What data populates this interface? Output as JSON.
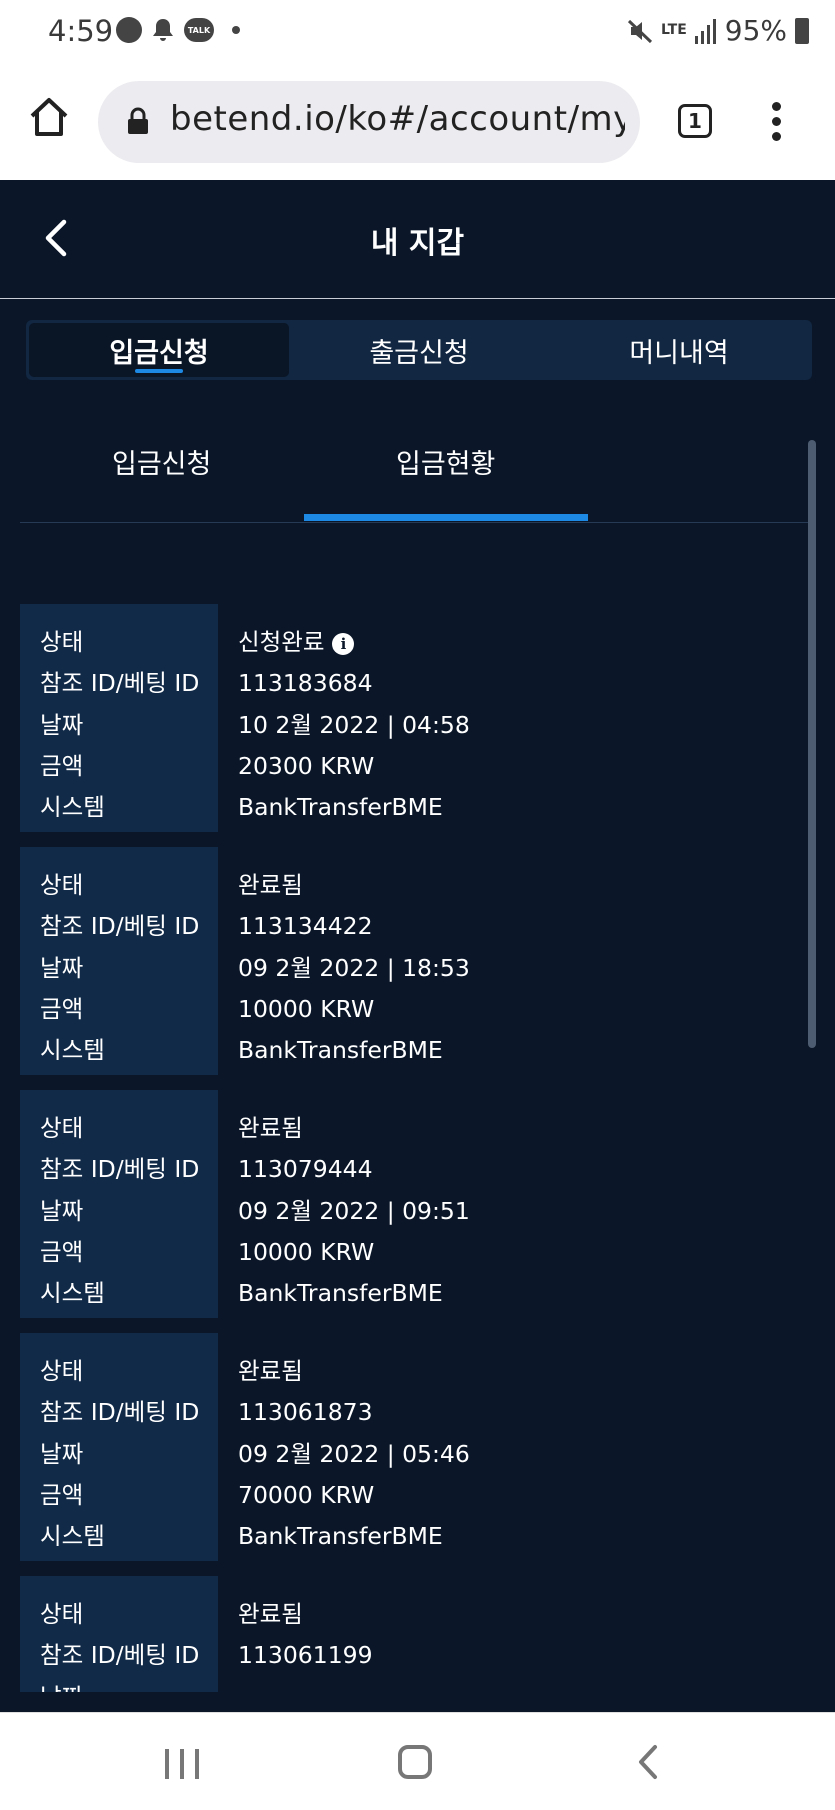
{
  "status_bar": {
    "time": "4:59",
    "notification_icons": [
      "basketball-icon",
      "bell-icon",
      "kakaotalk-icon",
      "dot-icon"
    ],
    "talk_label": "TALK",
    "network": "LTE",
    "battery": "95%"
  },
  "browser": {
    "url": "betend.io/ko#/account/my-w",
    "tab_count": "1"
  },
  "header": {
    "title": "내 지갑"
  },
  "main_tabs": [
    {
      "label": "입금신청",
      "active": true
    },
    {
      "label": "출금신청",
      "active": false
    },
    {
      "label": "머니내역",
      "active": false
    }
  ],
  "sub_tabs": [
    {
      "label": "입금신청",
      "active": false
    },
    {
      "label": "입금현황",
      "active": true
    }
  ],
  "field_labels": {
    "status": "상태",
    "ref_id": "참조 ID/베팅 ID",
    "date": "날짜",
    "amount": "금액",
    "system": "시스템"
  },
  "records": [
    {
      "status": "신청완료",
      "ref_id": "113183684",
      "date": "10 2월 2022 | 04:58",
      "amount": "20300 KRW",
      "system": "BankTransferBME"
    },
    {
      "status": "완료됨",
      "ref_id": "113134422",
      "date": "09 2월 2022 | 18:53",
      "amount": "10000 KRW",
      "system": "BankTransferBME"
    },
    {
      "status": "완료됨",
      "ref_id": "113079444",
      "date": "09 2월 2022 | 09:51",
      "amount": "10000 KRW",
      "system": "BankTransferBME"
    },
    {
      "status": "완료됨",
      "ref_id": "113061873",
      "date": "09 2월 2022 | 05:46",
      "amount": "70000 KRW",
      "system": "BankTransferBME"
    },
    {
      "status": "완료됨",
      "ref_id": "113061199",
      "date": "",
      "amount": "",
      "system": ""
    }
  ],
  "info_glyph": "i",
  "colors": {
    "background": "#0b1729",
    "label_column": "#112a48",
    "accent": "#1e88e5"
  }
}
